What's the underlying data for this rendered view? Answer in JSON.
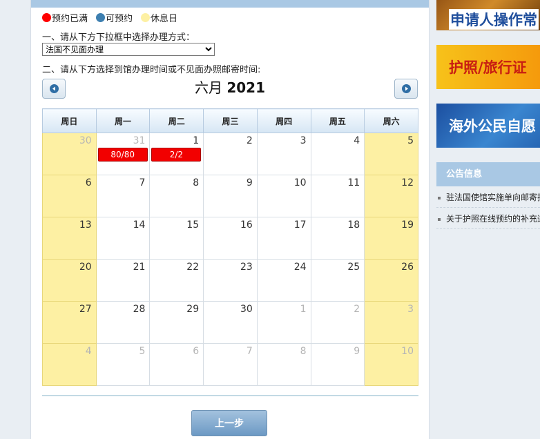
{
  "legend": {
    "full_label": "预约已满",
    "full_color": "#ff0000",
    "available_label": "可预约",
    "available_color": "#3d7fb0",
    "rest_label": "休息日",
    "rest_color": "#fdf0a3"
  },
  "step1_text": "一、请从下方下拉框中选择办理方式：",
  "method_select": {
    "selected": "法国不见面办理"
  },
  "step2_text": "二、请从下方选择到馆办理时间或不见面办照邮寄时间:",
  "calendar": {
    "month_label": "六月",
    "year_label": "2021",
    "weekdays": [
      "周日",
      "周一",
      "周二",
      "周三",
      "周四",
      "周五",
      "周六"
    ],
    "weeks": [
      [
        {
          "day": "30",
          "other": true
        },
        {
          "day": "31",
          "other": true,
          "badge": "80/80"
        },
        {
          "day": "1",
          "badge": "2/2"
        },
        {
          "day": "2"
        },
        {
          "day": "3"
        },
        {
          "day": "4"
        },
        {
          "day": "5"
        }
      ],
      [
        {
          "day": "6"
        },
        {
          "day": "7"
        },
        {
          "day": "8"
        },
        {
          "day": "9"
        },
        {
          "day": "10"
        },
        {
          "day": "11"
        },
        {
          "day": "12"
        }
      ],
      [
        {
          "day": "13"
        },
        {
          "day": "14"
        },
        {
          "day": "15"
        },
        {
          "day": "16"
        },
        {
          "day": "17"
        },
        {
          "day": "18"
        },
        {
          "day": "19"
        }
      ],
      [
        {
          "day": "20"
        },
        {
          "day": "21"
        },
        {
          "day": "22"
        },
        {
          "day": "23"
        },
        {
          "day": "24"
        },
        {
          "day": "25"
        },
        {
          "day": "26"
        }
      ],
      [
        {
          "day": "27"
        },
        {
          "day": "28"
        },
        {
          "day": "29"
        },
        {
          "day": "30"
        },
        {
          "day": "1",
          "other": true
        },
        {
          "day": "2",
          "other": true
        },
        {
          "day": "3",
          "other": true
        }
      ],
      [
        {
          "day": "4",
          "other": true
        },
        {
          "day": "5",
          "other": true
        },
        {
          "day": "6",
          "other": true
        },
        {
          "day": "7",
          "other": true
        },
        {
          "day": "8",
          "other": true
        },
        {
          "day": "9",
          "other": true
        },
        {
          "day": "10",
          "other": true
        }
      ]
    ]
  },
  "prev_step_label": "上一步",
  "sidebar": {
    "banners": [
      "申请人操作常",
      "护照/旅行证",
      "海外公民自愿"
    ],
    "notice_title": "公告信息",
    "notices": [
      "驻法国使馆实施单向邮寄护照",
      "关于护照在线预约的补充通知"
    ]
  }
}
